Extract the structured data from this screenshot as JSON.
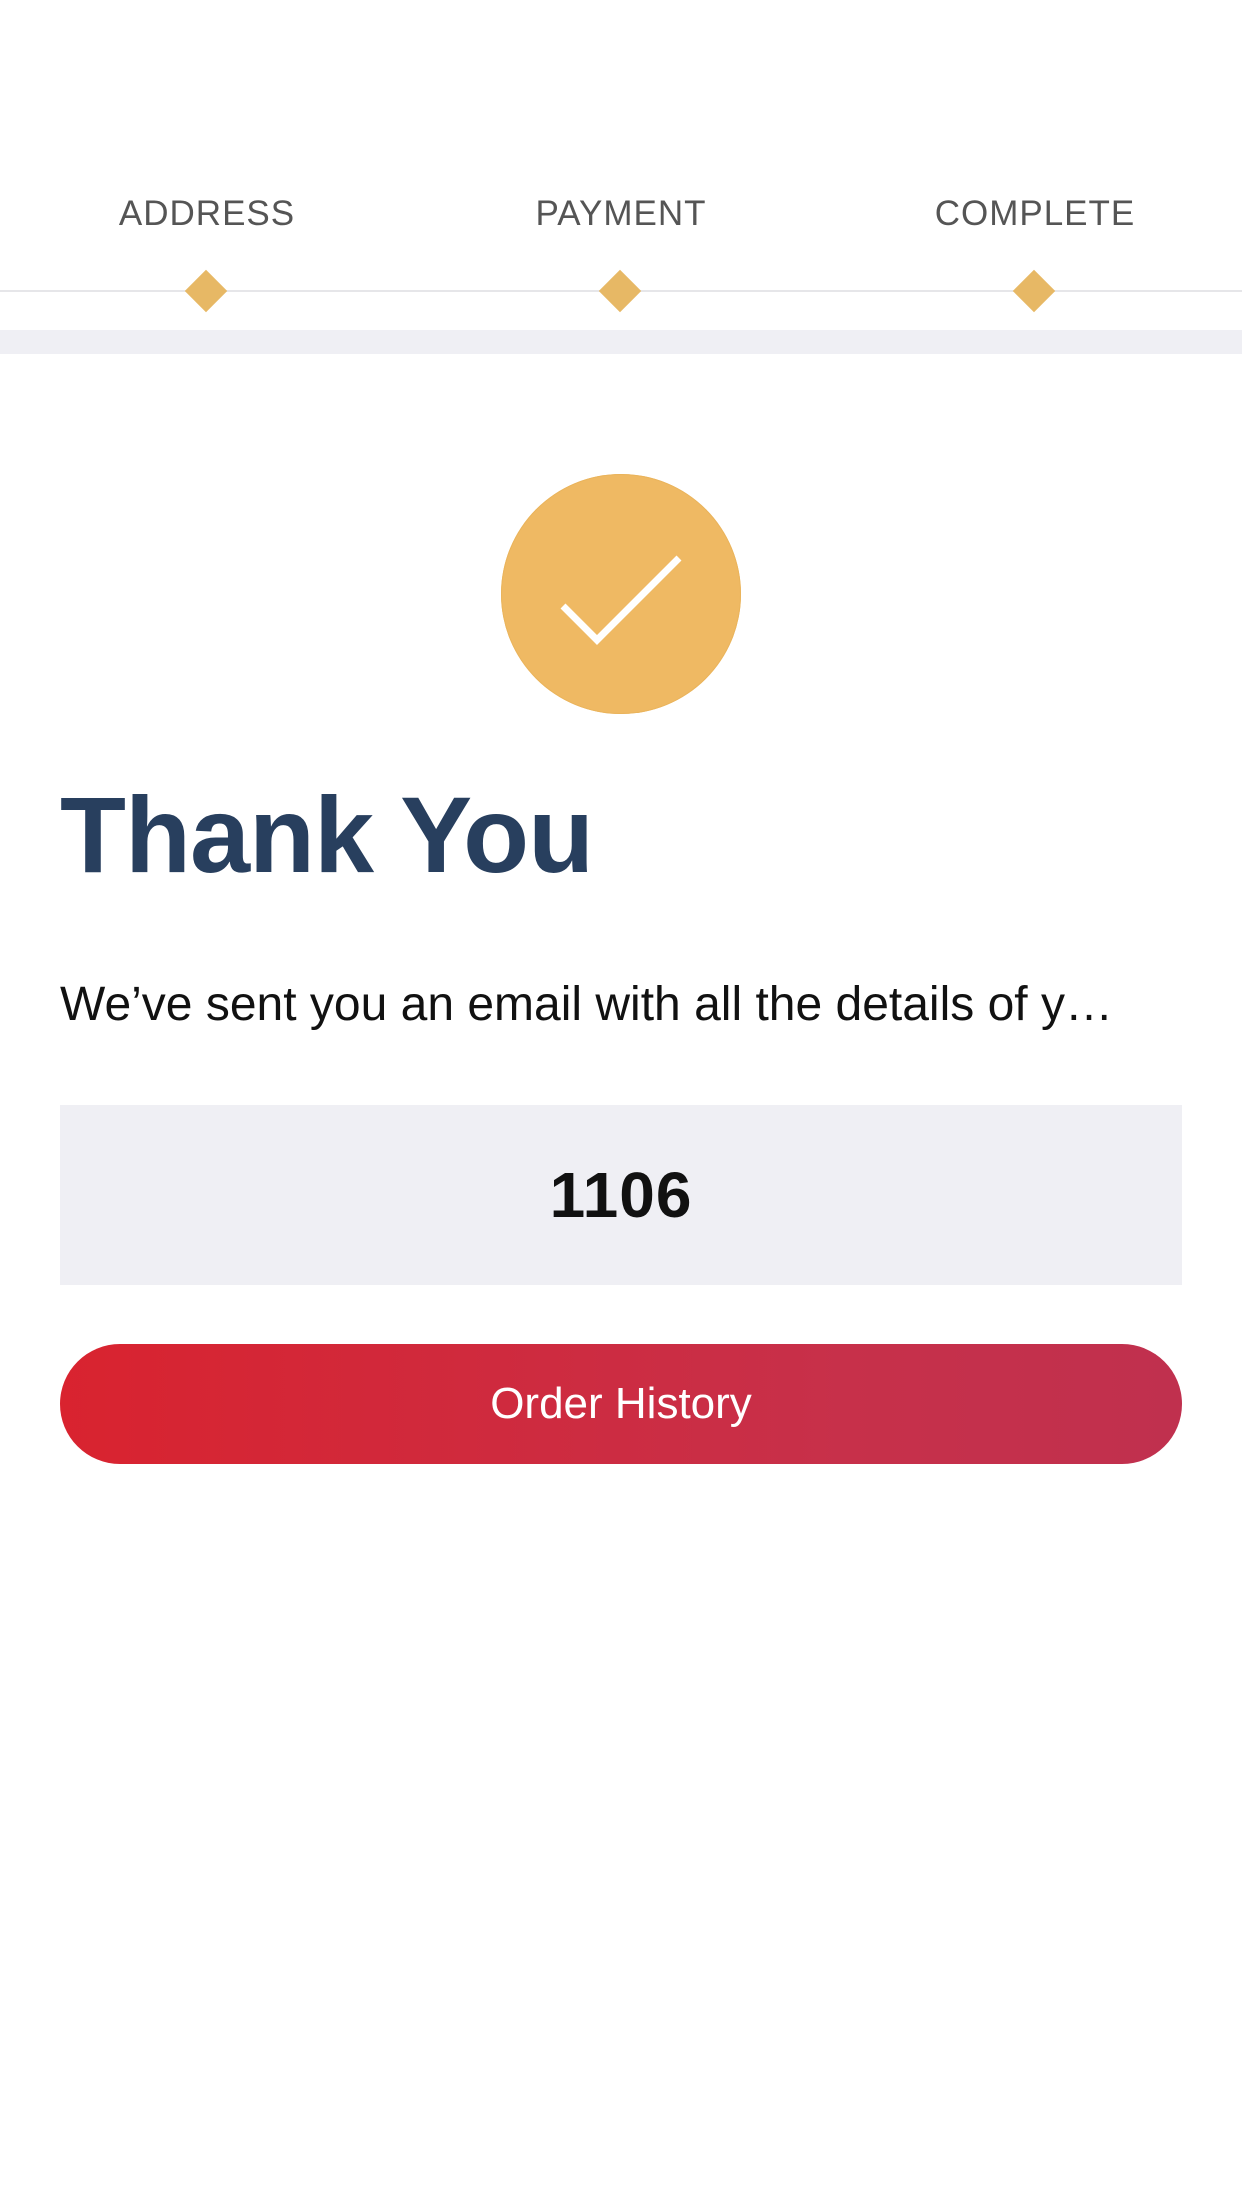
{
  "steps": [
    {
      "label": "ADDRESS"
    },
    {
      "label": "PAYMENT"
    },
    {
      "label": "COMPLETE"
    }
  ],
  "colors": {
    "accent": "#e7b865",
    "title": "#283f5e",
    "button_start": "#d9232f",
    "button_end": "#c0304e",
    "panel": "#efeff4"
  },
  "success_icon": "checkmark-icon",
  "title": "Thank You",
  "message": "We’ve sent you an email with all the details of y…",
  "order_number": "1106",
  "order_history_button": "Order History"
}
